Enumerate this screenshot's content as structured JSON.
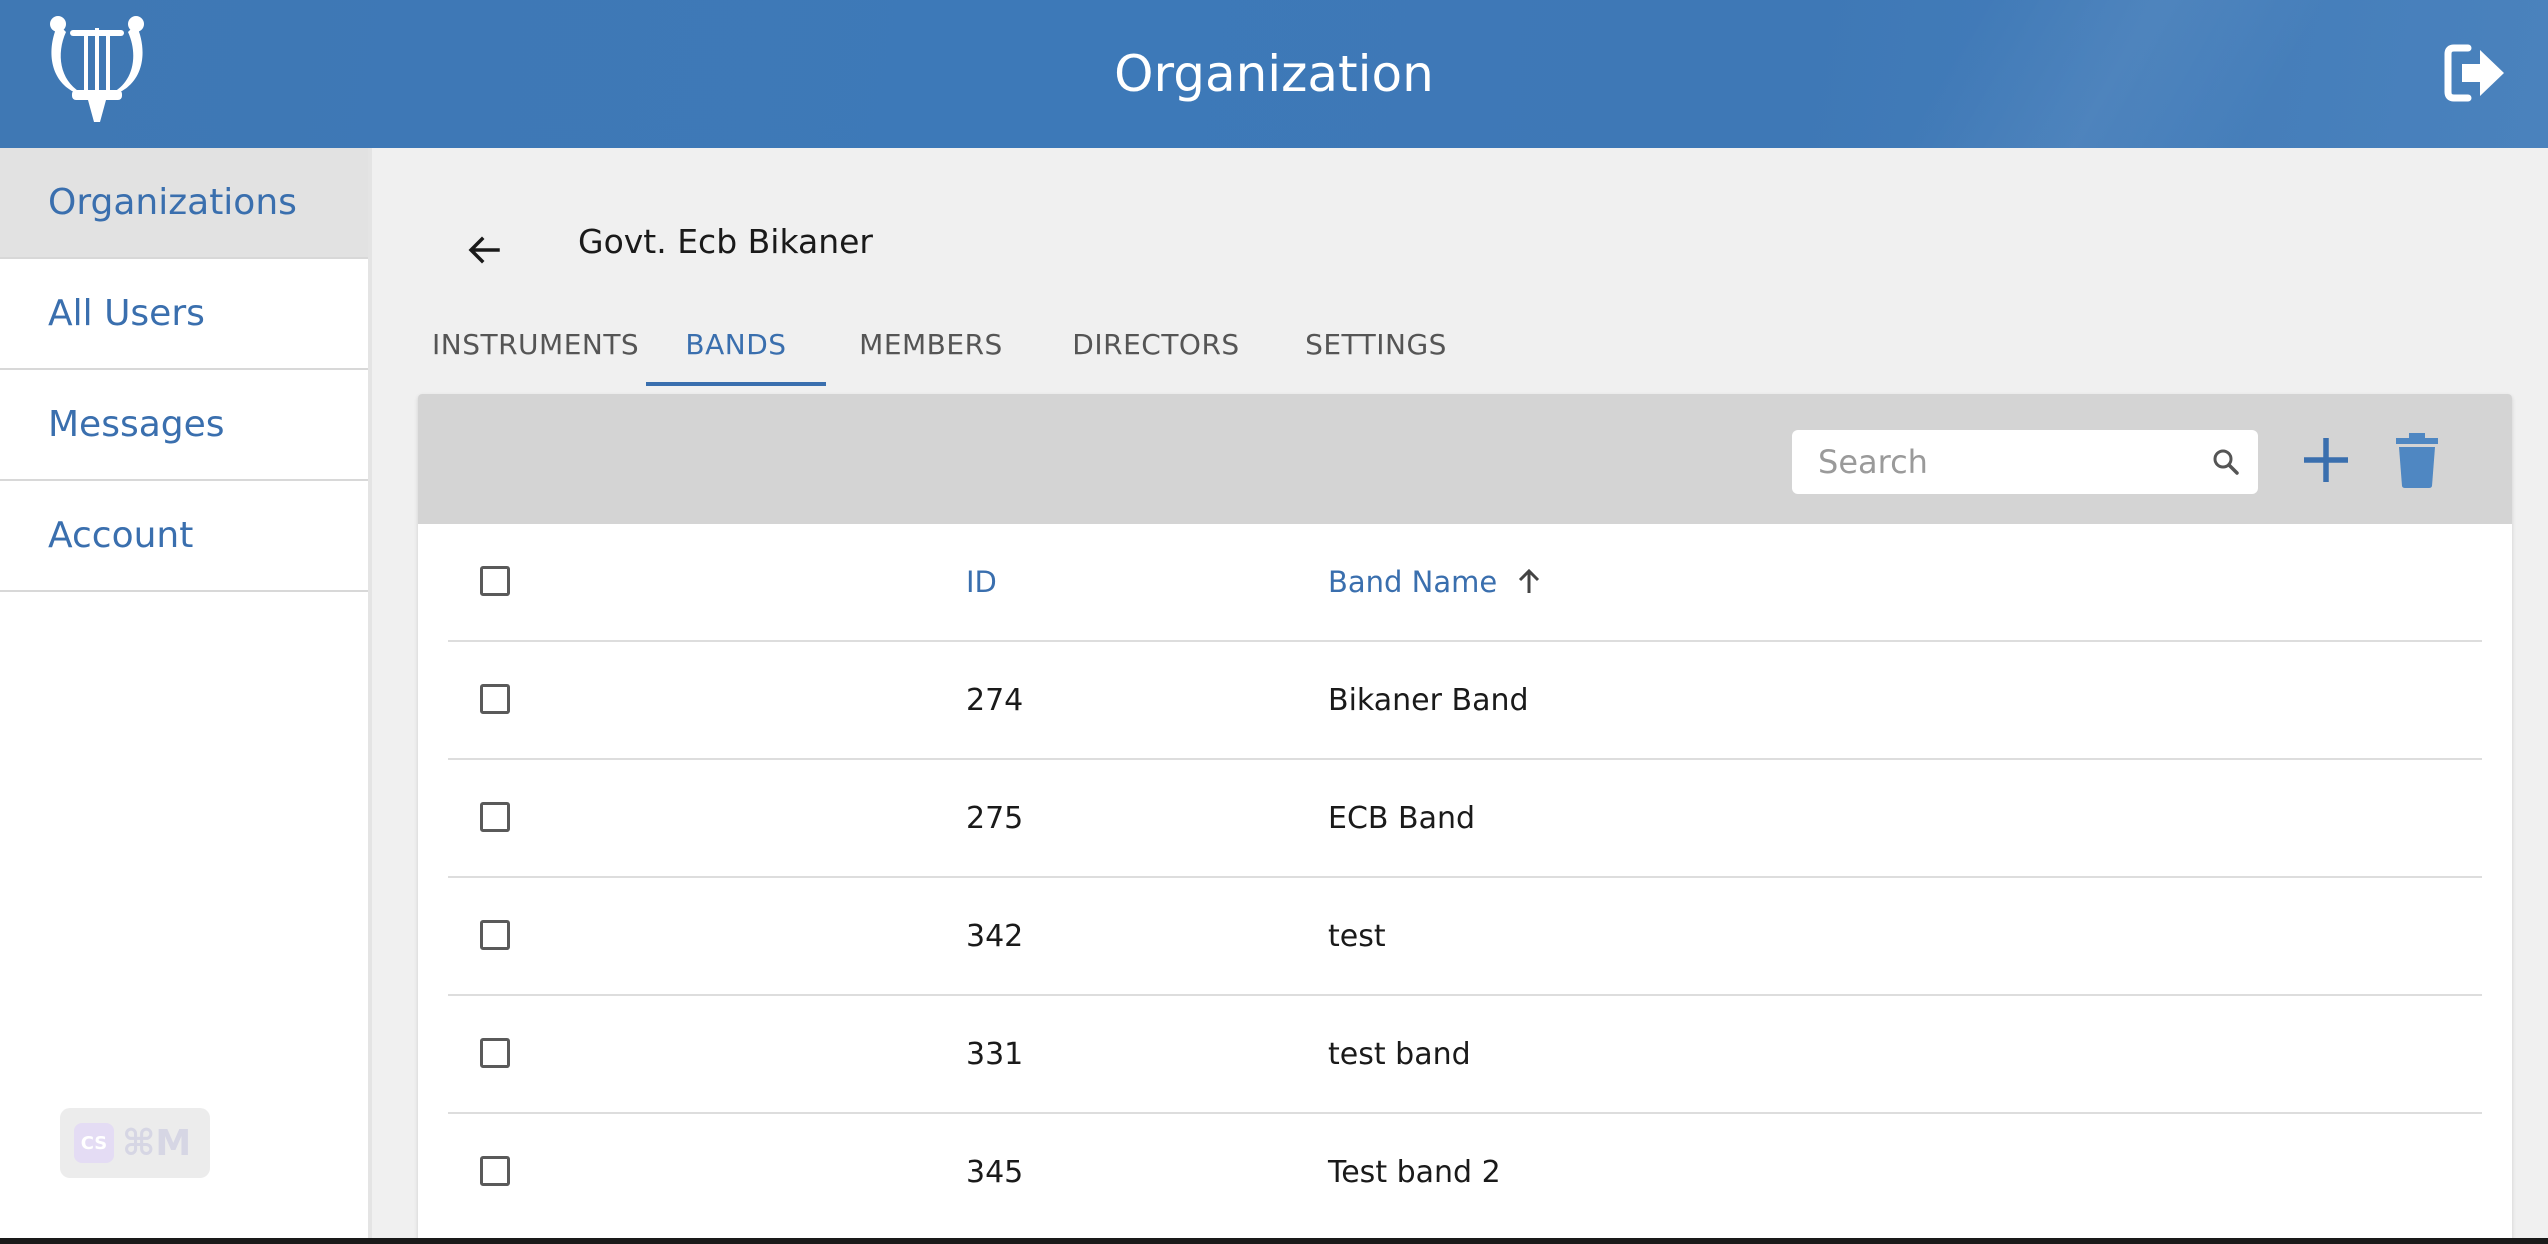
{
  "header": {
    "title": "Organization"
  },
  "sidebar": {
    "items": [
      {
        "label": "Organizations",
        "active": true
      },
      {
        "label": "All Users",
        "active": false
      },
      {
        "label": "Messages",
        "active": false
      },
      {
        "label": "Account",
        "active": false
      }
    ],
    "shortcut_badge": {
      "icon_text": "CS",
      "keys": "⌘M"
    }
  },
  "main": {
    "org_name": "Govt. Ecb Bikaner",
    "tabs": [
      {
        "label": "INSTRUMENTS",
        "active": false
      },
      {
        "label": "BANDS",
        "active": true
      },
      {
        "label": "MEMBERS",
        "active": false
      },
      {
        "label": "DIRECTORS",
        "active": false
      },
      {
        "label": "SETTINGS",
        "active": false
      }
    ],
    "search": {
      "placeholder": "Search",
      "value": ""
    },
    "table": {
      "columns": {
        "id": "ID",
        "name": "Band Name"
      },
      "sort": {
        "column": "Band Name",
        "direction": "ascending"
      },
      "rows": [
        {
          "id": "274",
          "name": "Bikaner Band",
          "checked": false
        },
        {
          "id": "275",
          "name": "ECB Band",
          "checked": false
        },
        {
          "id": "342",
          "name": "test",
          "checked": false
        },
        {
          "id": "331",
          "name": "test band",
          "checked": false
        },
        {
          "id": "345",
          "name": "Test band 2",
          "checked": false
        }
      ]
    }
  },
  "colors": {
    "header_bg": "#3d79b8",
    "accent": "#3a6fae",
    "toolbar_bg": "#d4d4d4",
    "page_bg": "#f0f0f0"
  }
}
